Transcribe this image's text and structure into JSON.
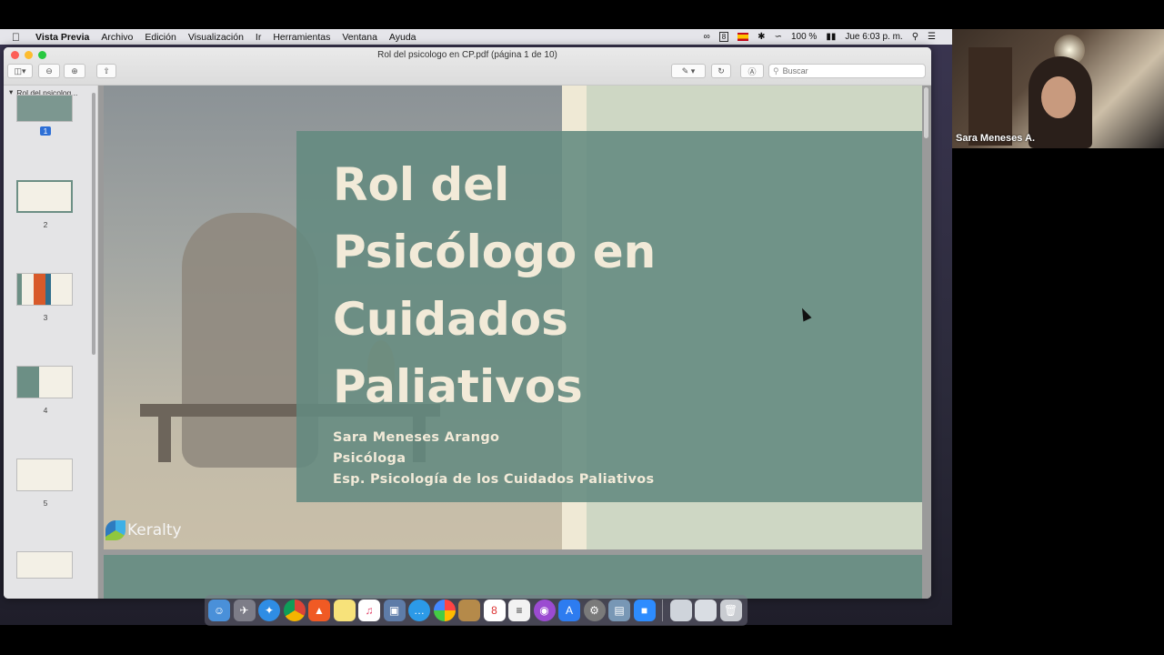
{
  "menubar": {
    "app_name": "Vista Previa",
    "items": [
      "Archivo",
      "Edición",
      "Visualización",
      "Ir",
      "Herramientas",
      "Ventana",
      "Ayuda"
    ],
    "status": {
      "box_number": "8",
      "battery": "100 %",
      "datetime": "Jue 6:03 p. m."
    }
  },
  "window": {
    "title": "Rol del psicologo en CP.pdf (página 1 de 10)",
    "search_placeholder": "Buscar"
  },
  "sidebar": {
    "document_name": "Rol del psicolog...",
    "page_numbers": [
      "1",
      "2",
      "3",
      "4",
      "5"
    ]
  },
  "slide": {
    "title_lines": [
      "Rol del",
      "Psicólogo en",
      "Cuidados",
      "Paliativos"
    ],
    "subtitle_lines": [
      "Sara Meneses Arango",
      "Psicóloga",
      "Esp. Psicología de los Cuidados Paliativos"
    ],
    "logo_text": "Keralty",
    "colors": {
      "panel": "#638a80",
      "background": "#ced7c4",
      "text": "#f2ead8"
    }
  },
  "video": {
    "participant_name": "Sara Meneses A."
  }
}
